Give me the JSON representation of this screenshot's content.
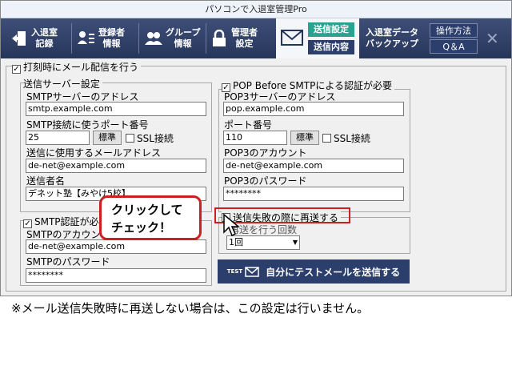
{
  "window": {
    "title": "パソコンで入退室管理Pro"
  },
  "toolbar": {
    "entry_record": [
      "入退室",
      "記録"
    ],
    "registrant_info": [
      "登録者",
      "情報"
    ],
    "group_info": [
      "グループ",
      "情報"
    ],
    "admin_settings": [
      "管理者",
      "設定"
    ],
    "send_settings": "送信設定",
    "send_content": "送信内容",
    "data_backup": [
      "入退室データ",
      "バックアップ"
    ],
    "how_to": "操作方法",
    "qa": "Q＆A"
  },
  "form": {
    "send_mail_on_stamp": "打刻時にメール配信を行う",
    "send_server_group": "送信サーバー設定",
    "smtp_server_label": "SMTPサーバーのアドレス",
    "smtp_server_value": "smtp.example.com",
    "smtp_port_label": "SMTP接続に使うポート番号",
    "smtp_port_value": "25",
    "standard_button": "標準",
    "ssl_label": "SSL接続",
    "sender_mail_label": "送信に使用するメールアドレス",
    "sender_mail_value": "de-net@example.com",
    "sender_name_label": "送信者名",
    "sender_name_value": "デネット塾【みやけ5校】",
    "smtp_auth_label": "SMTP認証が必",
    "smtp_account_label": "SMTPのアカウン",
    "smtp_account_value": "de-net@example.com",
    "smtp_password_label": "SMTPのパスワード",
    "smtp_password_value": "********",
    "pop_group": "POP Before SMTPによる認証が必要",
    "pop_server_label": "POP3サーバーのアドレス",
    "pop_server_value": "pop.example.com",
    "port_label": "ポート番号",
    "pop_port_value": "110",
    "pop_account_label": "POP3のアカウント",
    "pop_account_value": "de-net@example.com",
    "pop_password_label": "POP3のパスワード",
    "pop_password_value": "********",
    "resend_label": "送信失敗の際に再送する",
    "retry_label": "再送を行う回数",
    "retry_value": "1回",
    "test_tag": "TEST",
    "test_button": "自分にテストメールを送信する"
  },
  "callout": {
    "line1": "クリックして",
    "line2": "チェック！"
  },
  "note": "※メール送信失敗時に再送しない場合は、この設定は行いません。",
  "colors": {
    "toolbar": "#2c3e6b",
    "active_tab": "#2aa290",
    "callout_border": "#cc1f1f"
  }
}
